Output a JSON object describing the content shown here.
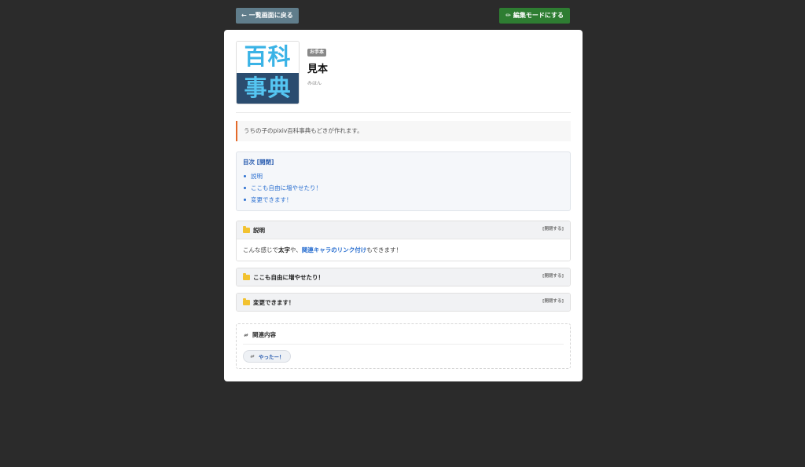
{
  "toolbar": {
    "back_label": "一覧画面に戻る",
    "edit_label": "編集モードにする"
  },
  "article": {
    "logo_top": "百科",
    "logo_bottom": "事典",
    "tag": "お手本",
    "title": "見本",
    "reading": "みほん",
    "summary": "うちの子のpixiv百科事典もどきが作れます。"
  },
  "toc": {
    "title": "目次",
    "toggle": "[開閉]",
    "items": [
      "説明",
      "ここも自由に増やせたり！",
      "変更できます！"
    ]
  },
  "sections": [
    {
      "title": "説明",
      "toggle": "[開閉する]",
      "body_pre": "こんな感じで",
      "body_bold": "太字",
      "body_mid": "や、",
      "body_link": "関連キャラのリンク付け",
      "body_post": "もできます！"
    },
    {
      "title": "ここも自由に増やせたり！",
      "toggle": "[開閉する]"
    },
    {
      "title": "変更できます！",
      "toggle": "[開閉する]"
    }
  ],
  "related": {
    "title": "関連内容",
    "items": [
      "やったー！"
    ]
  },
  "colors": {
    "back_button": "#607d8b",
    "edit_button": "#2e7d32",
    "summary_accent": "#e46a2a",
    "link": "#2a6fd0"
  }
}
